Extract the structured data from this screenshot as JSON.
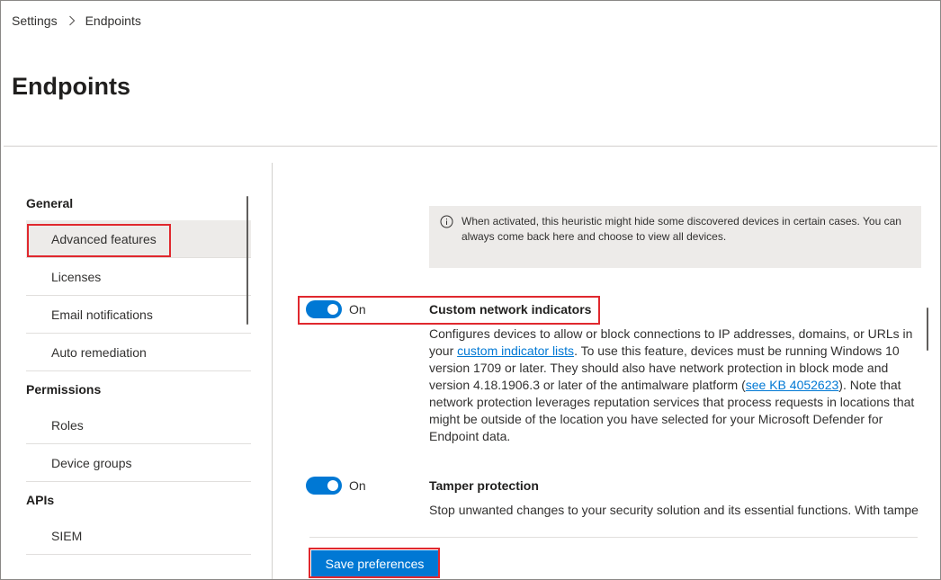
{
  "breadcrumb": {
    "root": "Settings",
    "current": "Endpoints"
  },
  "page": {
    "title": "Endpoints"
  },
  "nav": {
    "groups": [
      {
        "label": "General",
        "items": [
          "Advanced features",
          "Licenses",
          "Email notifications",
          "Auto remediation"
        ]
      },
      {
        "label": "Permissions",
        "items": [
          "Roles",
          "Device groups"
        ]
      },
      {
        "label": "APIs",
        "items": [
          "SIEM"
        ]
      }
    ],
    "selected": "Advanced features"
  },
  "info": {
    "icon": "info-icon",
    "text": "When activated, this heuristic might hide some discovered devices in certain cases. You can always come back here and choose to view all devices."
  },
  "settings": [
    {
      "toggle_state": "On",
      "title": "Custom network indicators",
      "desc_part1": "Configures devices to allow or block connections to IP addresses, domains, or URLs in your ",
      "link1": "custom indicator lists",
      "desc_part2": ". To use this feature, devices must be running Windows 10 version 1709 or later. They should also have network protection in block mode and version 4.18.1906.3 or later of the antimalware platform (",
      "link2": "see KB 4052623",
      "desc_part3": "). Note that network protection leverages reputation services that process requests in locations that might be outside of the location you have selected for your Microsoft Defender for Endpoint data."
    },
    {
      "toggle_state": "On",
      "title": "Tamper protection",
      "desc": "Stop unwanted changes to your security solution and its essential functions. With tamper"
    }
  ],
  "actions": {
    "save": "Save preferences"
  },
  "colors": {
    "accent": "#0078d4",
    "highlight": "#e0282e"
  }
}
